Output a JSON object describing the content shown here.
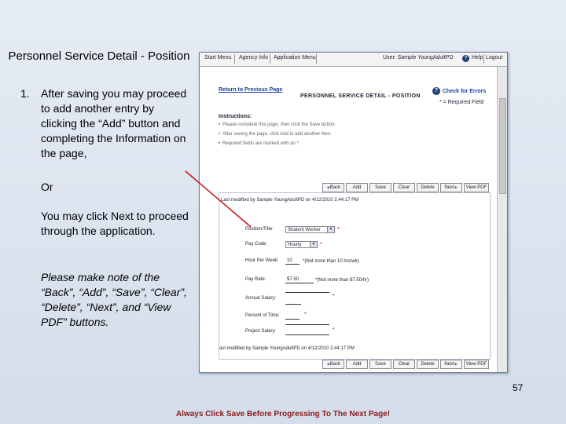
{
  "slide": {
    "title": "Personnel Service Detail - Position",
    "step_number": "1.",
    "step_text": "After saving you may proceed to add another entry by clicking the “Add” button and completing the Information on the page,",
    "or": "Or",
    "next_text": "You may click Next to proceed through the application.",
    "note_text": "Please make note of the “Back”, “Add”, “Save”, “Clear”, “Delete”, “Next”, and “View PDF” buttons.",
    "page_number": "57",
    "footer": "Always Click Save Before Progressing To The Next Page!"
  },
  "app": {
    "menu": {
      "start": "Start Menu",
      "agency": "Agency Info",
      "application": "Application Menu",
      "user": "User: Sample YoungAdultPD",
      "help": "Help",
      "logout": "Logout"
    },
    "return_link": "Return to Previous Page",
    "form_title": "PERSONNEL SERVICE DETAIL - POSITION",
    "check_errors": "Check for Errors",
    "required_note": "* = Required Field",
    "instructions_title": "Instructions:",
    "instructions": [
      "Please complete this page, then click the Save button.",
      "After saving the page, click Add to add another item.",
      "Required fields are marked with an *."
    ],
    "buttons": [
      "Back",
      "Add",
      "Save",
      "Clear",
      "Delete",
      "Next",
      "View PDF"
    ],
    "last_modified_top": "Last modified by Sample YoungAdultPD on 4/12/2010 2:44:17 PM",
    "last_modified_bottom": "ast modified by Sample YoungAdultPD on 4/12/2010 2:44:17 PM",
    "fields": {
      "position_label": "Position/Title:",
      "position_value": "Student Worker",
      "pay_code_label": "Pay Code:",
      "pay_code_value": "Hourly",
      "hours_label": "Hour Per Week:",
      "hours_value": "10",
      "hours_hint": "*(Not more than 10 hrs/wk)",
      "pay_rate_label": "Pay Rate:",
      "pay_rate_value": "$7.50",
      "pay_rate_hint": "*(Not more than $7.50/hr)",
      "annual_label": "Annual Salary:",
      "percent_label": "Percent of Time:",
      "project_label": "Project Salary:",
      "req": "*"
    }
  }
}
